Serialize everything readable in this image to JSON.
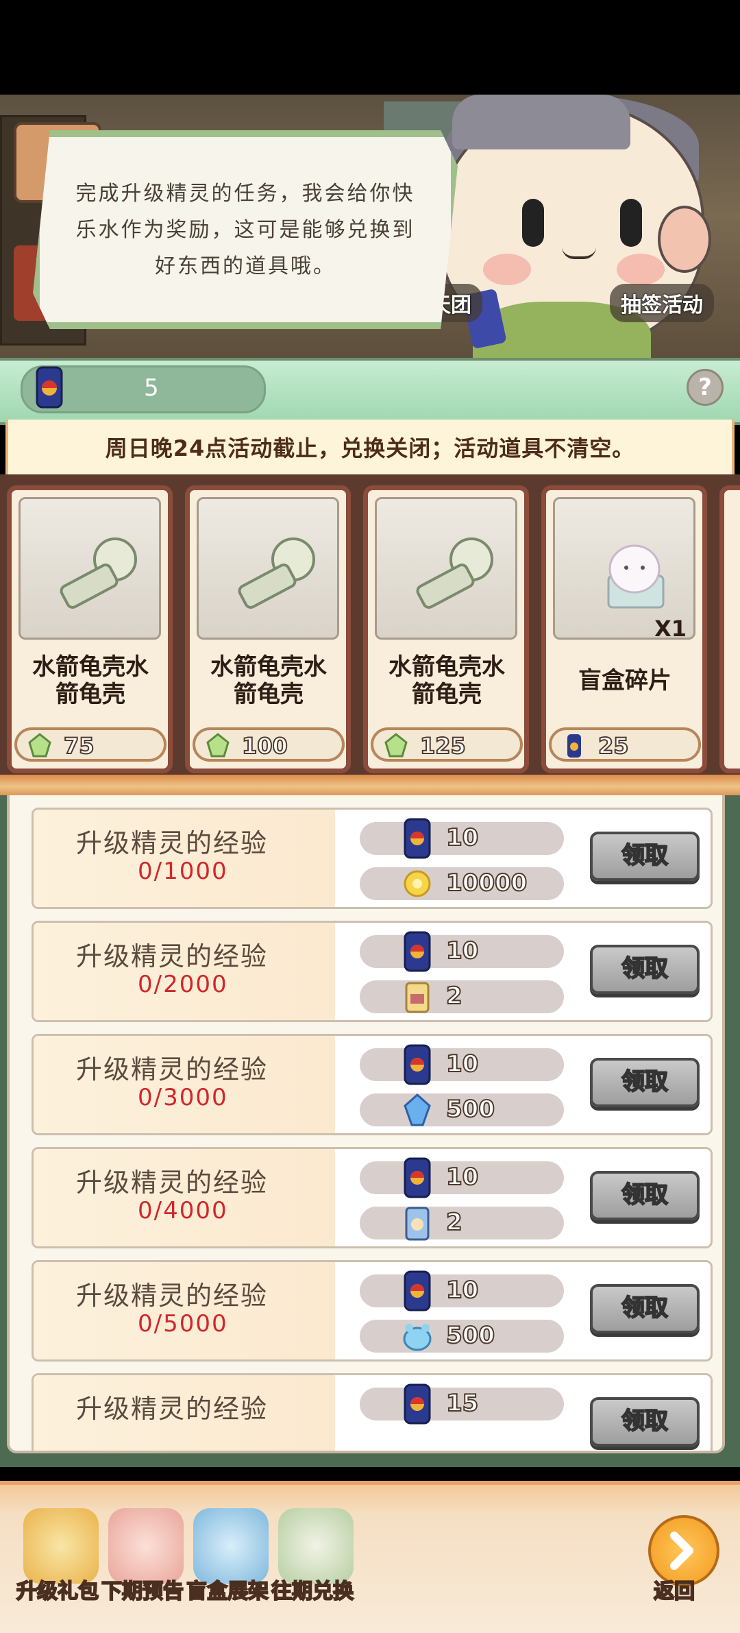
{
  "dialog": {
    "text": "完成升级精灵的任务，我会给你快乐水作为奖励，这可是能够兑换到好东西的道具哦。"
  },
  "scene": {
    "tag_left": "天团",
    "tag_right": "抽签活动"
  },
  "currency": {
    "icon": "soda-can-icon",
    "value": "5"
  },
  "notice": "周日晚24点活动截止，兑换关闭；活动道具不清空。",
  "shop": {
    "items": [
      {
        "name_line1": "水箭龟壳水",
        "name_line2": "箭龟壳",
        "price": "75",
        "price_icon": "crystal-icon"
      },
      {
        "name_line1": "水箭龟壳水",
        "name_line2": "箭龟壳",
        "price": "100",
        "price_icon": "crystal-icon"
      },
      {
        "name_line1": "水箭龟壳水",
        "name_line2": "箭龟壳",
        "price": "125",
        "price_icon": "crystal-icon"
      },
      {
        "name_line1": "盲盒碎片",
        "name_line2": "",
        "qty": "X1",
        "price": "25",
        "price_icon": "soda-can-icon"
      }
    ]
  },
  "tasks": [
    {
      "title": "升级精灵的经验",
      "progress": "0/1000",
      "reward1": "10",
      "reward2": "10000",
      "reward2_icon": "gold-coin-icon",
      "button": "领取"
    },
    {
      "title": "升级精灵的经验",
      "progress": "0/2000",
      "reward1": "10",
      "reward2": "2",
      "reward2_icon": "candy-bag-icon",
      "button": "领取"
    },
    {
      "title": "升级精灵的经验",
      "progress": "0/3000",
      "reward1": "10",
      "reward2": "500",
      "reward2_icon": "blue-gem-icon",
      "button": "领取"
    },
    {
      "title": "升级精灵的经验",
      "progress": "0/4000",
      "reward1": "10",
      "reward2": "2",
      "reward2_icon": "food-bag-icon",
      "button": "领取"
    },
    {
      "title": "升级精灵的经验",
      "progress": "0/5000",
      "reward1": "10",
      "reward2": "500",
      "reward2_icon": "blue-pet-icon",
      "button": "领取"
    },
    {
      "title": "升级精灵的经验",
      "progress": "",
      "reward1": "15",
      "reward2": "",
      "reward2_icon": "",
      "button": "领取"
    }
  ],
  "nav": {
    "items": [
      {
        "label": "升级礼包",
        "icon": "gift-pack-icon"
      },
      {
        "label": "下期预告",
        "icon": "party-horn-icon"
      },
      {
        "label": "盲盒展架",
        "icon": "display-shelf-icon"
      },
      {
        "label": "往期兑换",
        "icon": "calendar-icon"
      }
    ],
    "back_label": "返回"
  }
}
